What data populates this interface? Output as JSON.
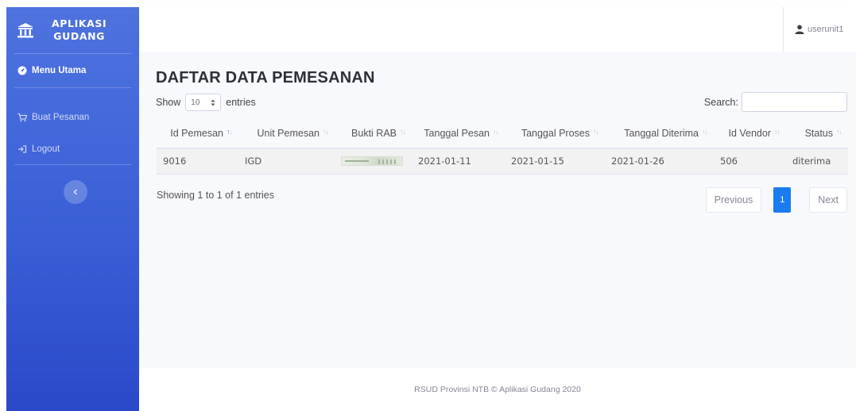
{
  "sidebar": {
    "brand_line1": "APLIKASI",
    "brand_line2": "GUDANG",
    "items": [
      {
        "label": "Menu Utama",
        "icon": "dashboard-icon"
      },
      {
        "label": "Buat Pesanan",
        "icon": "cart-icon"
      },
      {
        "label": "Logout",
        "icon": "logout-icon"
      }
    ],
    "toggle_icon": "chevron-left-icon"
  },
  "topbar": {
    "username": "userunit1",
    "user_icon": "user-icon"
  },
  "main": {
    "title": "DAFTAR DATA PEMESANAN",
    "show_label": "Show",
    "entries_value": "10",
    "entries_label": "entries",
    "search_label": "Search:",
    "search_value": "",
    "columns": [
      "Id Pemesan",
      "Unit Pemesan",
      "Bukti RAB",
      "Tanggal Pesan",
      "Tanggal Proses",
      "Tanggal Diterima",
      "Id Vendor",
      "Status"
    ],
    "rows": [
      {
        "id_pemesan": "9016",
        "unit_pemesan": "IGD",
        "bukti_rab": "rab-thumbnail",
        "tanggal_pesan": "2021-01-11",
        "tanggal_proses": "2021-01-15",
        "tanggal_diterima": "2021-01-26",
        "id_vendor": "506",
        "status": "diterima"
      }
    ],
    "info": "Showing 1 to 1 of 1 entries",
    "pagination": {
      "previous": "Previous",
      "current": "1",
      "next": "Next"
    }
  },
  "footer": {
    "text": "RSUD Provinsi NTB © Aplikasi Gudang 2020"
  },
  "colors": {
    "sidebar": "#4e73df",
    "accent": "#1a7cf0",
    "background": "#f8f9fc"
  }
}
